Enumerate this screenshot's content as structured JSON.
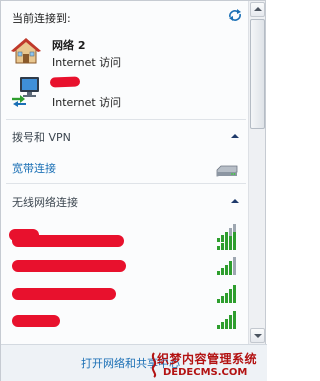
{
  "connected_header": {
    "label": "当前连接到:",
    "refresh_icon": "refresh-arrows-icon"
  },
  "networks": [
    {
      "name": "网络  2",
      "status": "Internet 访问",
      "icon": "home-network-icon",
      "name_redacted": false
    },
    {
      "name": "",
      "status": "Internet 访问",
      "icon": "pc-network-icon",
      "name_redacted": true
    }
  ],
  "dialup_section": {
    "title": "拨号和 VPN",
    "items": [
      {
        "label": "宽带连接",
        "icon": "modem-icon"
      }
    ]
  },
  "wireless_section": {
    "title": "无线网络连接",
    "networks": [
      {
        "name_redacted": true,
        "signal_bars": 5,
        "icon": "wifi-signal-icon"
      },
      {
        "name_redacted": true,
        "signal_bars": 5,
        "icon": "wifi-signal-icon"
      },
      {
        "name_redacted": true,
        "signal_bars": 5,
        "icon": "wifi-signal-icon"
      },
      {
        "name_redacted": true,
        "signal_bars": 5,
        "icon": "wifi-signal-icon"
      }
    ]
  },
  "footer": {
    "link": "打开网络和共享中心"
  },
  "watermark": {
    "line1": "织梦内容管理系统",
    "line2": "DEDECMS.COM"
  },
  "colors": {
    "link": "#1a6fb5",
    "redaction": "#e8112d",
    "signal_green": "#2e9e2e",
    "watermark": "#b31212"
  }
}
